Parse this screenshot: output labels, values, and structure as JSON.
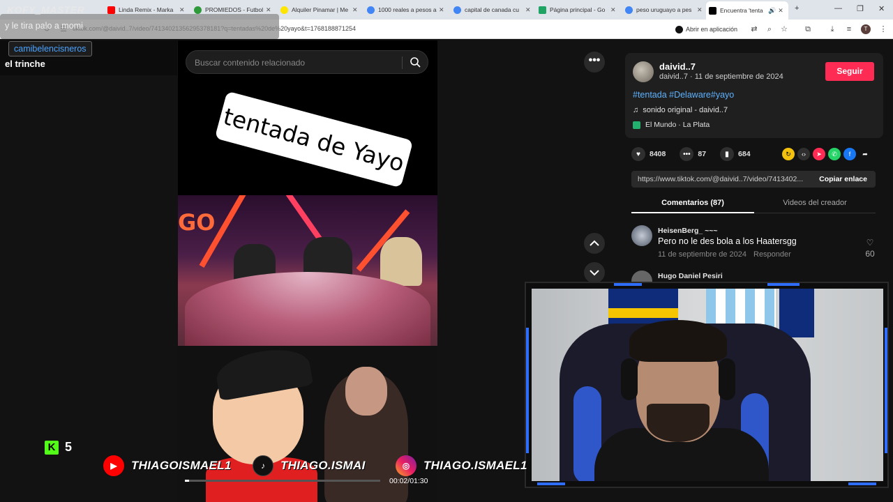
{
  "browser": {
    "tabs": [
      {
        "title": "Linda Remix - Marka",
        "color": "#ff0000"
      },
      {
        "title": "PROMIEDOS - Futbol",
        "color": "#2e9a3a"
      },
      {
        "title": "Alquiler Pinamar | Me",
        "color": "#ffe500"
      },
      {
        "title": "1000 reales a pesos a",
        "color": "#4285f4"
      },
      {
        "title": "capital de canada cu",
        "color": "#4285f4"
      },
      {
        "title": "Página principal - Go",
        "color": "#1fa463"
      },
      {
        "title": "peso uruguayo a pes",
        "color": "#4285f4"
      },
      {
        "title": "Encuentra 'tenta",
        "color": "#000000"
      }
    ],
    "url": "tiktok.com/@daivid..7/video/7413402135629537818​1?q=tentadas%20de%20yayo&t=1768188871254",
    "open_in_app": "Abrir en aplicación",
    "profile_initial": "T"
  },
  "overlay": {
    "kofy": "KOFY_MASTER",
    "chat_line": "y le tira palo a momi",
    "chat_user": "camibelencisneros",
    "chat_message": "el trinche",
    "kick_count": "5",
    "youtube": "THIAGOISMAEL1",
    "tiktok": "THIAGO.ISMAI",
    "instagram": "THIAGO.ISMAEL1"
  },
  "video": {
    "search_placeholder": "Buscar contenido relacionado",
    "caption": "tentada de Yayo",
    "studio_sign": "GO",
    "time": "00:02/01:30",
    "progress": 0.022
  },
  "details": {
    "creator": "daivid..7",
    "sub": "daivid..7 · 11 de septiembre de 2024",
    "follow": "Seguir",
    "tags": "#tentada #Delaware#yayo",
    "sound": "sonido original - daivid..7",
    "location": "El Mundo · La Plata",
    "likes": "8408",
    "comments_count": "87",
    "saves": "684",
    "share_url": "https://www.tiktok.com/@daivid..7/video/7413402...",
    "copy_label": "Copiar enlace",
    "tab_comments": "Comentarios (87)",
    "tab_videos": "Videos del creador"
  },
  "comments": [
    {
      "user": "HeisenBerg_ ~~~",
      "text": "Pero no le des bola a los Haatersgg",
      "date": "11 de septiembre de 2024",
      "reply": "Responder",
      "likes": "60"
    },
    {
      "user": "Hugo Daniel Pesiri"
    }
  ],
  "colors": {
    "accent": "#fe2c55",
    "link": "#5fb2ff",
    "kick": "#53fc18",
    "cam_accent": "#2f6dff"
  }
}
